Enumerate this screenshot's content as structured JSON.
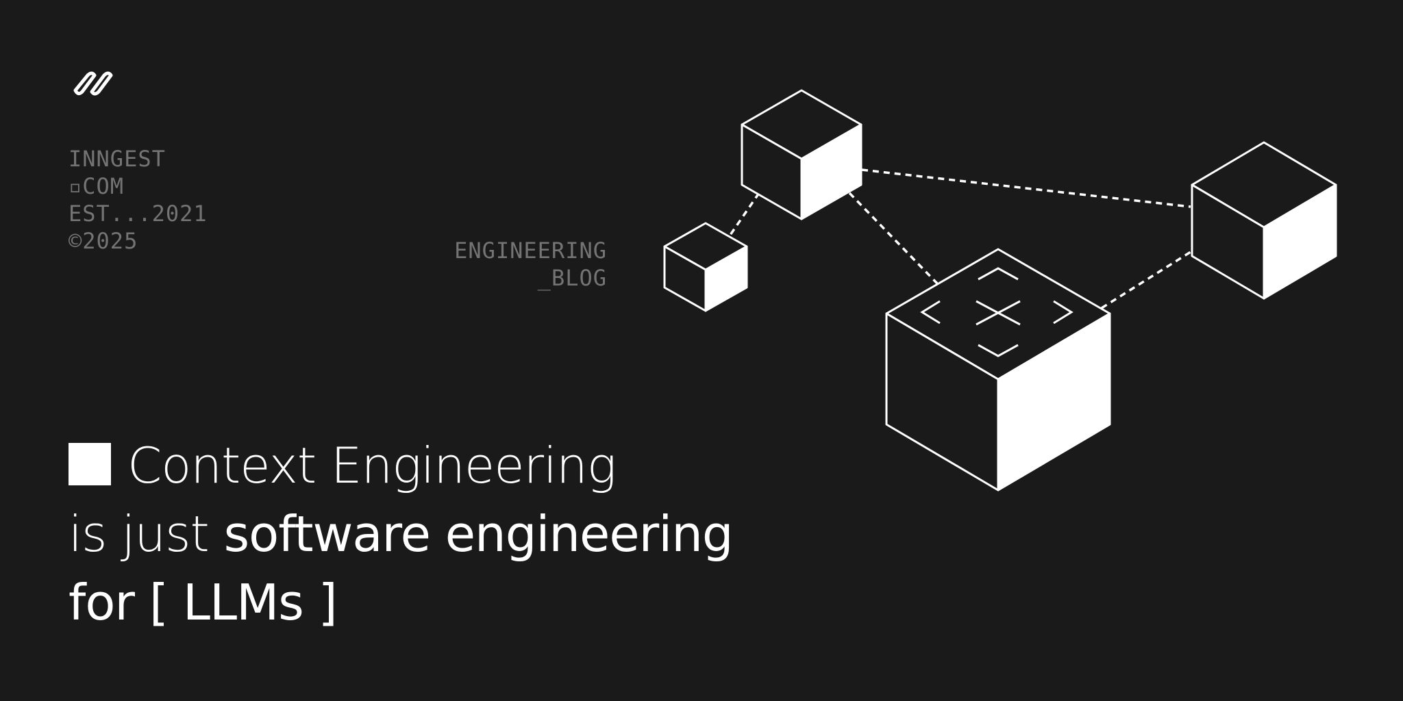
{
  "brand": {
    "logo_icon": "inngest-logo-icon",
    "meta_lines": [
      "INNGEST",
      "▫COM",
      "EST...2021",
      "©2025"
    ]
  },
  "section": {
    "lines": [
      "ENGINEERING",
      "_BLOG"
    ]
  },
  "headline": {
    "line1": "Context Engineering",
    "line2_prefix": "is just ",
    "line2_emphasis": "software engineering",
    "line3": "for [ LLMs ]"
  },
  "colors": {
    "background": "#1a1a1a",
    "foreground": "#ffffff",
    "muted": "#747474"
  },
  "illustration": {
    "icon": "isometric-cubes-network-illustration"
  }
}
